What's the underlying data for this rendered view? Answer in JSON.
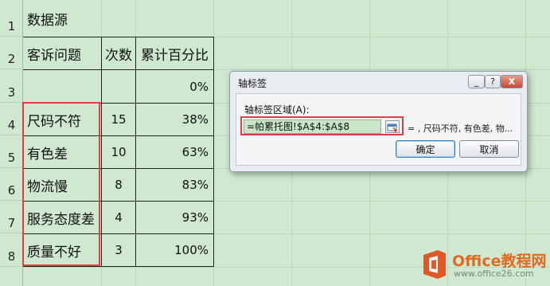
{
  "rows": [
    "1",
    "2",
    "3",
    "4",
    "5",
    "6",
    "7",
    "8"
  ],
  "title": "数据源",
  "table": {
    "headers": [
      "客诉问题",
      "次数",
      "累计百分比"
    ],
    "row3_percent": "0%",
    "data": [
      {
        "issue": "尺码不符",
        "count": "15",
        "percent": "38%"
      },
      {
        "issue": "有色差",
        "count": "10",
        "percent": "63%"
      },
      {
        "issue": "物流慢",
        "count": "8",
        "percent": "83%"
      },
      {
        "issue": "服务态度差",
        "count": "4",
        "percent": "93%"
      },
      {
        "issue": "质量不好",
        "count": "3",
        "percent": "100%"
      }
    ]
  },
  "dialog": {
    "title": "轴标签",
    "minimize": "_",
    "maximize": "?",
    "close": "X",
    "field_label": "轴标签区域(A):",
    "range_value": "=帕累托图!$A$4:$A$8",
    "preview": "= , 尺码不符, 有色差, 物...",
    "ok": "确定",
    "cancel": "取消"
  },
  "watermark": {
    "text": "Office教程网",
    "url": "www.office26.com"
  },
  "colors": {
    "sheet_bg": "#cfe8cf",
    "highlight": "#e04040",
    "input_bg": "#c8e6c8",
    "brand": "#e06a22"
  }
}
